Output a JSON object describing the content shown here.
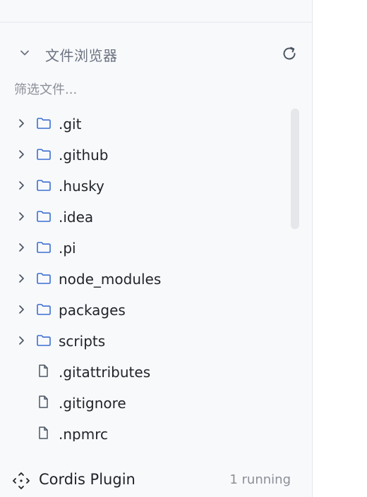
{
  "panel": {
    "title": "文件浏览器",
    "filter_placeholder": "筛选文件..."
  },
  "tree": [
    {
      "name": ".git",
      "type": "folder"
    },
    {
      "name": ".github",
      "type": "folder"
    },
    {
      "name": ".husky",
      "type": "folder"
    },
    {
      "name": ".idea",
      "type": "folder"
    },
    {
      "name": ".pi",
      "type": "folder"
    },
    {
      "name": "node_modules",
      "type": "folder"
    },
    {
      "name": "packages",
      "type": "folder"
    },
    {
      "name": "scripts",
      "type": "folder"
    },
    {
      "name": ".gitattributes",
      "type": "file"
    },
    {
      "name": ".gitignore",
      "type": "file"
    },
    {
      "name": ".npmrc",
      "type": "file"
    }
  ],
  "footer": {
    "plugin_name": "Cordis Plugin",
    "status": "1 running"
  },
  "colors": {
    "folder_icon": "#3b6fd1",
    "muted_text": "#8b8f97",
    "sidebar_bg": "#f8f9fb"
  },
  "icons": {
    "collapse": "chevron-down-icon",
    "refresh": "refresh-icon",
    "folder": "folder-icon",
    "file": "file-icon",
    "expand": "chevron-right-icon",
    "plugin": "move-arrows-icon"
  }
}
